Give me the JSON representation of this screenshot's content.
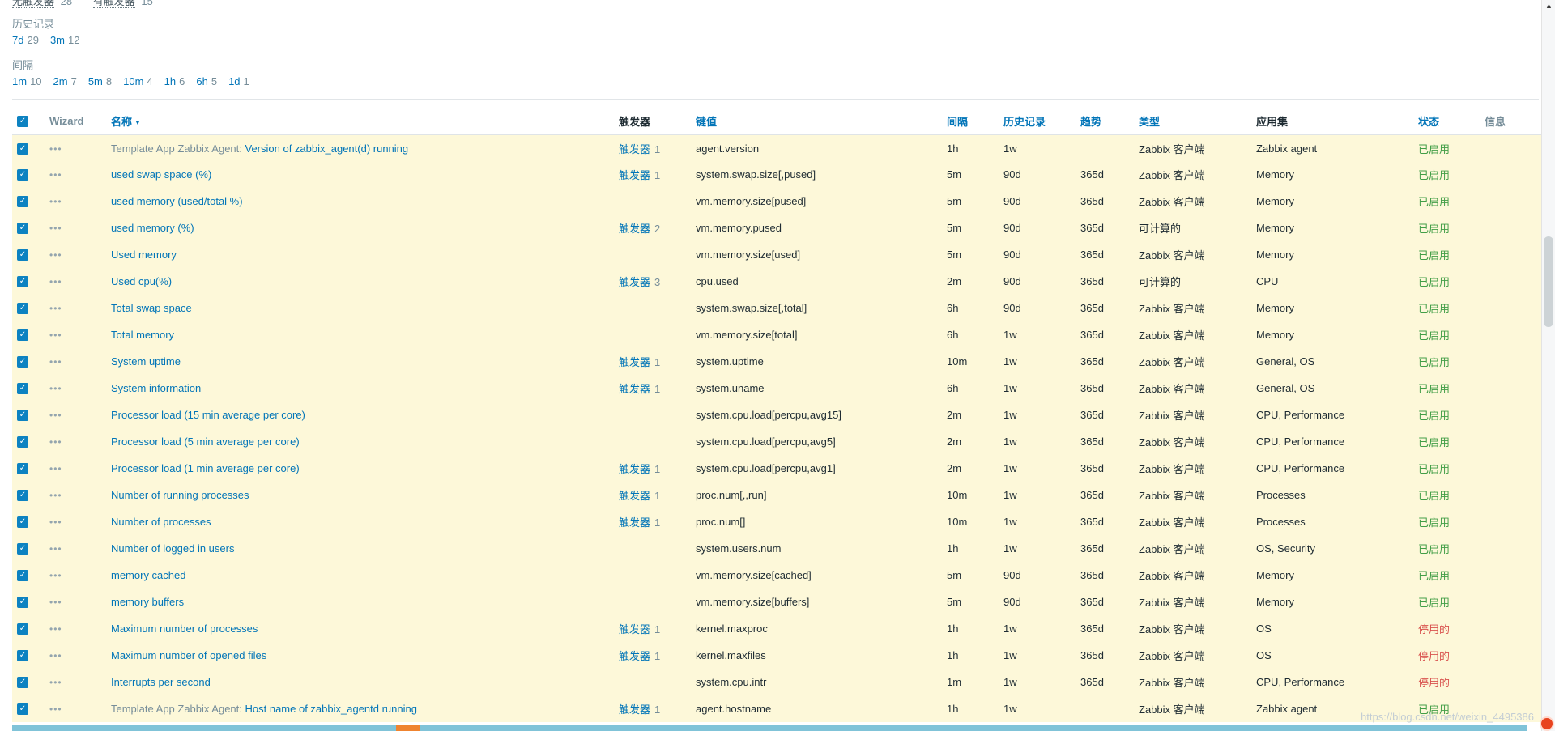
{
  "page": {
    "watermark": "https://blog.csdn.net/weixin_4495386",
    "colors": {
      "link_blue": "#0275b8",
      "row_highlight": "#fdf8d9",
      "status_enabled_green": "#429e47",
      "status_disabled_red": "#d9534f",
      "muted_gray": "#768d99"
    }
  },
  "icons": {
    "check": "✓",
    "wizard_dots": "•••",
    "sort_desc": "▼",
    "scroll_up": "▲"
  },
  "top_subfilter": {
    "items": [
      {
        "label": "无触发器",
        "count": "28"
      },
      {
        "label": "有触发器",
        "count": "15"
      }
    ]
  },
  "subfilters": [
    {
      "label": "历史记录",
      "options": [
        {
          "label": "7d",
          "count": "29"
        },
        {
          "label": "3m",
          "count": "12"
        }
      ]
    },
    {
      "label": "间隔",
      "options": [
        {
          "label": "1m",
          "count": "10"
        },
        {
          "label": "2m",
          "count": "7"
        },
        {
          "label": "5m",
          "count": "8"
        },
        {
          "label": "10m",
          "count": "4"
        },
        {
          "label": "1h",
          "count": "6"
        },
        {
          "label": "6h",
          "count": "5"
        },
        {
          "label": "1d",
          "count": "1"
        }
      ]
    }
  ],
  "table": {
    "all_checked": true,
    "trigger_link_label": "触发器",
    "headers": {
      "wizard": "Wizard",
      "name": "名称",
      "triggers": "触发器",
      "key": "键值",
      "interval": "间隔",
      "history": "历史记录",
      "trends": "趋势",
      "type": "类型",
      "applications": "应用集",
      "status": "状态",
      "info": "信息"
    },
    "rows": [
      {
        "prefix": "Template App Zabbix Agent: ",
        "name": "Version of zabbix_agent(d) running",
        "triggers": "1",
        "key": "agent.version",
        "interval": "1h",
        "history": "1w",
        "trends": "",
        "type": "Zabbix 客户端",
        "applications": "Zabbix agent",
        "status": "已启用",
        "enabled": true
      },
      {
        "prefix": "",
        "name": "used swap space (%)",
        "triggers": "1",
        "key": "system.swap.size[,pused]",
        "interval": "5m",
        "history": "90d",
        "trends": "365d",
        "type": "Zabbix 客户端",
        "applications": "Memory",
        "status": "已启用",
        "enabled": true
      },
      {
        "prefix": "",
        "name": "used memory (used/total %)",
        "triggers": "",
        "key": "vm.memory.size[pused]",
        "interval": "5m",
        "history": "90d",
        "trends": "365d",
        "type": "Zabbix 客户端",
        "applications": "Memory",
        "status": "已启用",
        "enabled": true
      },
      {
        "prefix": "",
        "name": "used memory (%)",
        "triggers": "2",
        "key": "vm.memory.pused",
        "interval": "5m",
        "history": "90d",
        "trends": "365d",
        "type": "可计算的",
        "applications": "Memory",
        "status": "已启用",
        "enabled": true
      },
      {
        "prefix": "",
        "name": "Used memory",
        "triggers": "",
        "key": "vm.memory.size[used]",
        "interval": "5m",
        "history": "90d",
        "trends": "365d",
        "type": "Zabbix 客户端",
        "applications": "Memory",
        "status": "已启用",
        "enabled": true
      },
      {
        "prefix": "",
        "name": "Used cpu(%)",
        "triggers": "3",
        "key": "cpu.used",
        "interval": "2m",
        "history": "90d",
        "trends": "365d",
        "type": "可计算的",
        "applications": "CPU",
        "status": "已启用",
        "enabled": true
      },
      {
        "prefix": "",
        "name": "Total swap space",
        "triggers": "",
        "key": "system.swap.size[,total]",
        "interval": "6h",
        "history": "90d",
        "trends": "365d",
        "type": "Zabbix 客户端",
        "applications": "Memory",
        "status": "已启用",
        "enabled": true
      },
      {
        "prefix": "",
        "name": "Total memory",
        "triggers": "",
        "key": "vm.memory.size[total]",
        "interval": "6h",
        "history": "1w",
        "trends": "365d",
        "type": "Zabbix 客户端",
        "applications": "Memory",
        "status": "已启用",
        "enabled": true
      },
      {
        "prefix": "",
        "name": "System uptime",
        "triggers": "1",
        "key": "system.uptime",
        "interval": "10m",
        "history": "1w",
        "trends": "365d",
        "type": "Zabbix 客户端",
        "applications": "General, OS",
        "status": "已启用",
        "enabled": true
      },
      {
        "prefix": "",
        "name": "System information",
        "triggers": "1",
        "key": "system.uname",
        "interval": "6h",
        "history": "1w",
        "trends": "365d",
        "type": "Zabbix 客户端",
        "applications": "General, OS",
        "status": "已启用",
        "enabled": true
      },
      {
        "prefix": "",
        "name": "Processor load (15 min average per core)",
        "triggers": "",
        "key": "system.cpu.load[percpu,avg15]",
        "interval": "2m",
        "history": "1w",
        "trends": "365d",
        "type": "Zabbix 客户端",
        "applications": "CPU, Performance",
        "status": "已启用",
        "enabled": true
      },
      {
        "prefix": "",
        "name": "Processor load (5 min average per core)",
        "triggers": "",
        "key": "system.cpu.load[percpu,avg5]",
        "interval": "2m",
        "history": "1w",
        "trends": "365d",
        "type": "Zabbix 客户端",
        "applications": "CPU, Performance",
        "status": "已启用",
        "enabled": true
      },
      {
        "prefix": "",
        "name": "Processor load (1 min average per core)",
        "triggers": "1",
        "key": "system.cpu.load[percpu,avg1]",
        "interval": "2m",
        "history": "1w",
        "trends": "365d",
        "type": "Zabbix 客户端",
        "applications": "CPU, Performance",
        "status": "已启用",
        "enabled": true
      },
      {
        "prefix": "",
        "name": "Number of running processes",
        "triggers": "1",
        "key": "proc.num[,,run]",
        "interval": "10m",
        "history": "1w",
        "trends": "365d",
        "type": "Zabbix 客户端",
        "applications": "Processes",
        "status": "已启用",
        "enabled": true
      },
      {
        "prefix": "",
        "name": "Number of processes",
        "triggers": "1",
        "key": "proc.num[]",
        "interval": "10m",
        "history": "1w",
        "trends": "365d",
        "type": "Zabbix 客户端",
        "applications": "Processes",
        "status": "已启用",
        "enabled": true
      },
      {
        "prefix": "",
        "name": "Number of logged in users",
        "triggers": "",
        "key": "system.users.num",
        "interval": "1h",
        "history": "1w",
        "trends": "365d",
        "type": "Zabbix 客户端",
        "applications": "OS, Security",
        "status": "已启用",
        "enabled": true
      },
      {
        "prefix": "",
        "name": "memory cached",
        "triggers": "",
        "key": "vm.memory.size[cached]",
        "interval": "5m",
        "history": "90d",
        "trends": "365d",
        "type": "Zabbix 客户端",
        "applications": "Memory",
        "status": "已启用",
        "enabled": true
      },
      {
        "prefix": "",
        "name": "memory buffers",
        "triggers": "",
        "key": "vm.memory.size[buffers]",
        "interval": "5m",
        "history": "90d",
        "trends": "365d",
        "type": "Zabbix 客户端",
        "applications": "Memory",
        "status": "已启用",
        "enabled": true
      },
      {
        "prefix": "",
        "name": "Maximum number of processes",
        "triggers": "1",
        "key": "kernel.maxproc",
        "interval": "1h",
        "history": "1w",
        "trends": "365d",
        "type": "Zabbix 客户端",
        "applications": "OS",
        "status": "停用的",
        "enabled": false
      },
      {
        "prefix": "",
        "name": "Maximum number of opened files",
        "triggers": "1",
        "key": "kernel.maxfiles",
        "interval": "1h",
        "history": "1w",
        "trends": "365d",
        "type": "Zabbix 客户端",
        "applications": "OS",
        "status": "停用的",
        "enabled": false
      },
      {
        "prefix": "",
        "name": "Interrupts per second",
        "triggers": "",
        "key": "system.cpu.intr",
        "interval": "1m",
        "history": "1w",
        "trends": "365d",
        "type": "Zabbix 客户端",
        "applications": "CPU, Performance",
        "status": "停用的",
        "enabled": false
      },
      {
        "prefix": "Template App Zabbix Agent: ",
        "name": "Host name of zabbix_agentd running",
        "triggers": "1",
        "key": "agent.hostname",
        "interval": "1h",
        "history": "1w",
        "trends": "",
        "type": "Zabbix 客户端",
        "applications": "Zabbix agent",
        "status": "已启用",
        "enabled": true
      }
    ]
  }
}
